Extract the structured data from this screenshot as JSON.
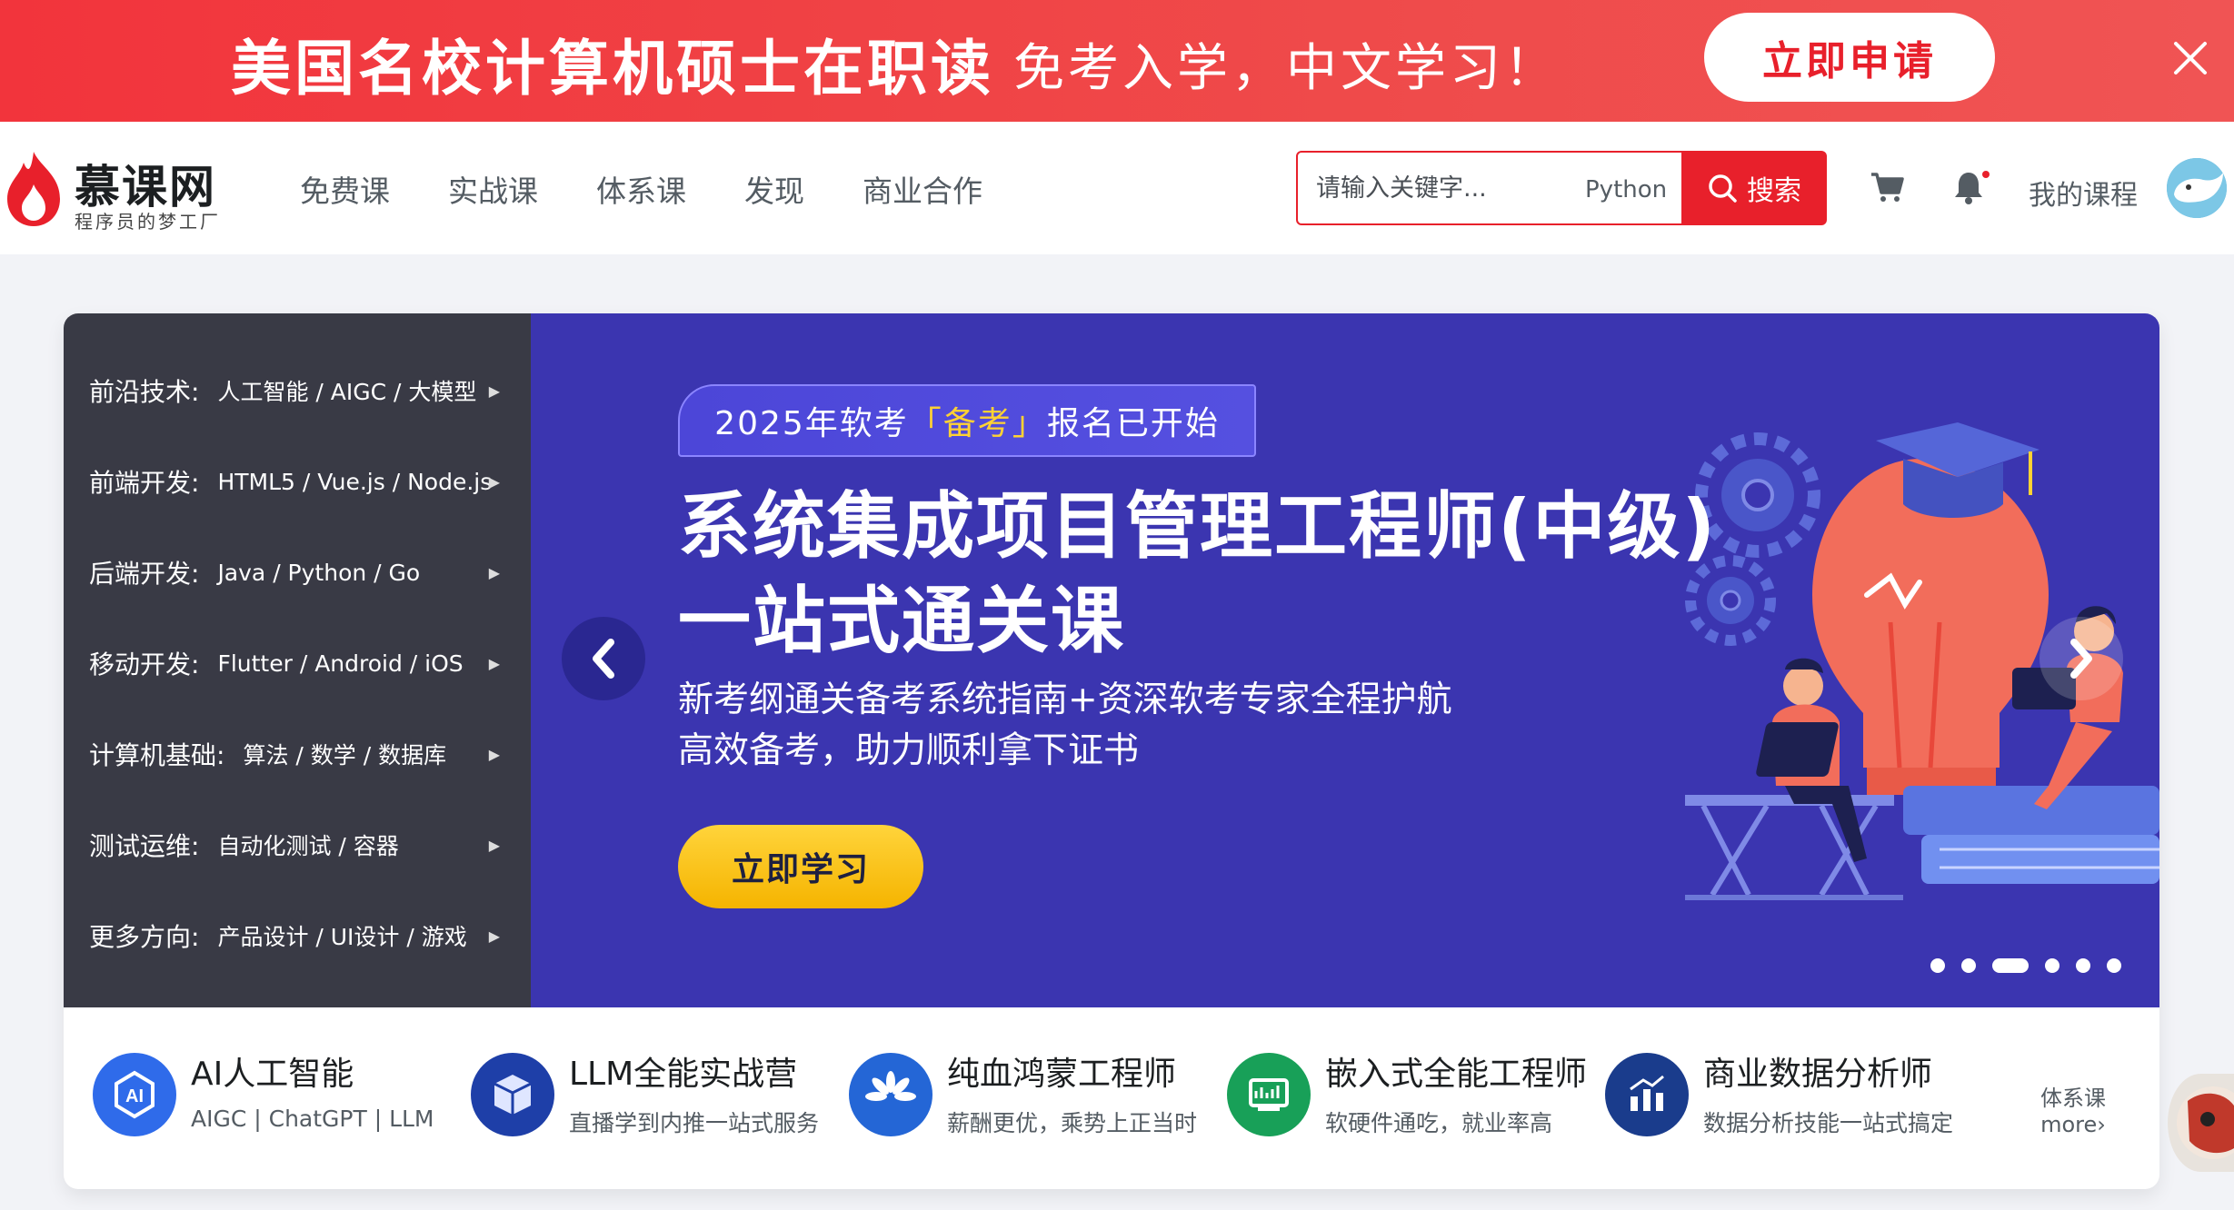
{
  "promo": {
    "headline": "美国名校计算机硕士在职读",
    "subline": "免考入学，中文学习！",
    "cta_label": "立即申请",
    "close_icon": "close-icon"
  },
  "header": {
    "logo_name": "慕课网",
    "logo_slogan": "程序员的梦工厂",
    "nav": [
      "免费课",
      "实战课",
      "体系课",
      "发现",
      "商业合作"
    ],
    "search_placeholder": "请输入关键字...",
    "search_hot": "Python",
    "search_button": "搜索",
    "cart_icon": "cart-icon",
    "bell_icon": "bell-icon",
    "my_courses": "我的课程"
  },
  "menu": {
    "items": [
      {
        "category": "前沿技术:",
        "tags": "人工智能 / AIGC / 大模型"
      },
      {
        "category": "前端开发:",
        "tags": "HTML5 / Vue.js / Node.js"
      },
      {
        "category": "后端开发:",
        "tags": "Java / Python / Go"
      },
      {
        "category": "移动开发:",
        "tags": "Flutter / Android / iOS"
      },
      {
        "category": "计算机基础:",
        "tags": "算法 / 数学 / 数据库"
      },
      {
        "category": "测试运维:",
        "tags": "自动化测试 / 容器"
      },
      {
        "category": "更多方向:",
        "tags": "产品设计 / UI设计 / 游戏"
      }
    ]
  },
  "hero": {
    "badge_pre": "2025年软考",
    "badge_highlight": "「备考」",
    "badge_post": "报名已开始",
    "title_line1": "系统集成项目管理工程师(中级)",
    "title_line2": "一站式通关课",
    "desc_line1": "新考纲通关备考系统指南+资深软考专家全程护航",
    "desc_line2": "高效备考，助力顺利拿下证书",
    "study_button": "立即学习",
    "slide_count": 6,
    "active_slide": 3,
    "colors": {
      "bg": "#3b35b0",
      "accent": "#ffd233"
    }
  },
  "strip": {
    "items": [
      {
        "title": "AI人工智能",
        "subtitle": "AIGC | ChatGPT | LLM",
        "color": "#2f6bea",
        "icon": "ai-icon"
      },
      {
        "title": "LLM全能实战营",
        "subtitle": "直播学到内推一站式服务",
        "color": "#1e3fa8",
        "icon": "cube-icon"
      },
      {
        "title": "纯血鸿蒙工程师",
        "subtitle": "薪酬更优，乘势上正当时",
        "color": "#2466d6",
        "icon": "harmony-icon"
      },
      {
        "title": "嵌入式全能工程师",
        "subtitle": "软硬件通吃，就业率高",
        "color": "#18a058",
        "icon": "chip-icon"
      },
      {
        "title": "商业数据分析师",
        "subtitle": "数据分析技能一站式搞定",
        "color": "#1a3c8c",
        "icon": "chart-icon"
      }
    ],
    "more_top": "体系课",
    "more_bottom": "more›"
  }
}
